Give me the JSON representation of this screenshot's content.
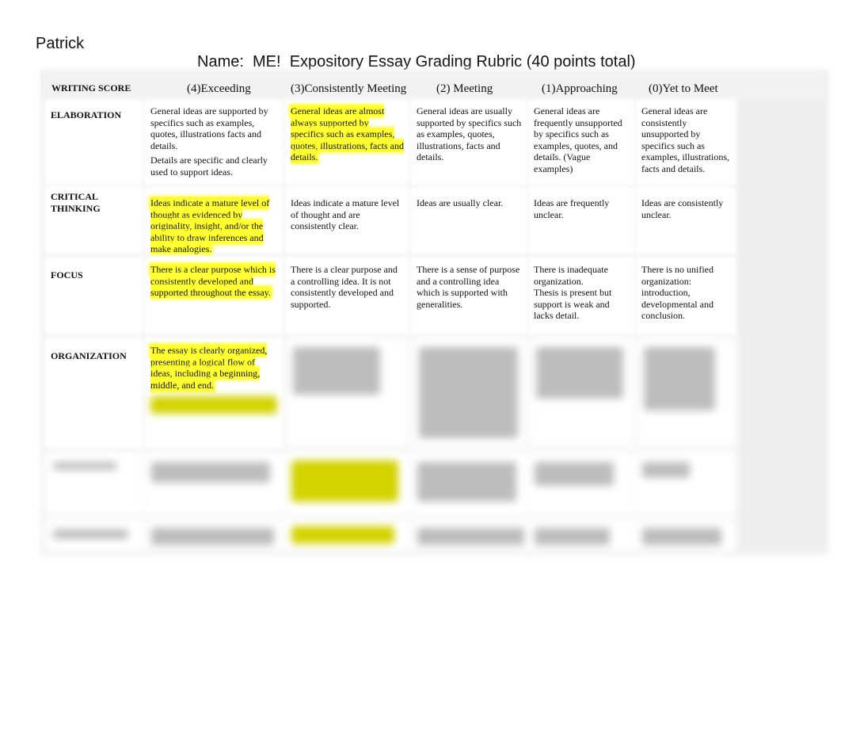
{
  "header": {
    "student_name": "Patrick",
    "title": "Name:  ME!  Expository Essay Grading Rubric (40 points total)"
  },
  "rubric": {
    "corner_label": "WRITING SCORE",
    "columns": [
      "(4)Exceeding",
      "(3)Consistently Meeting",
      "(2) Meeting",
      "(1)Approaching",
      "(0)Yet to Meet"
    ],
    "rows": [
      {
        "label": "ELABORATION",
        "cells": [
          {
            "text": "General ideas are supported by specifics such as examples, quotes, illustrations facts and details.",
            "text2": "Details are specific and clearly used to support ideas.",
            "highlighted": false
          },
          {
            "text": "General ideas are almost always supported by specifics such as examples, quotes, illustrations, facts and details.",
            "highlighted": true
          },
          {
            "text": "General ideas are usually supported by specifics such as examples, quotes, illustrations, facts and details.",
            "highlighted": false
          },
          {
            "text": "General ideas are frequently unsupported by specifics such as examples, quotes, and details. (Vague examples)",
            "highlighted": false
          },
          {
            "text": "General ideas are consistently unsupported by specifics such as examples, illustrations, facts and details.",
            "highlighted": false
          }
        ]
      },
      {
        "label": "CRITICAL THINKING",
        "cells": [
          {
            "text": "Ideas indicate a mature level of thought as evidenced by originality, insight, and/or the ability to draw inferences and make analogies.",
            "highlighted": true
          },
          {
            "text": "Ideas indicate a mature level of thought and are consistently clear.",
            "highlighted": false
          },
          {
            "text": "Ideas are usually clear.",
            "highlighted": false
          },
          {
            "text": "Ideas are frequently unclear.",
            "highlighted": false
          },
          {
            "text": "Ideas are consistently unclear.",
            "highlighted": false
          }
        ]
      },
      {
        "label": "FOCUS",
        "cells": [
          {
            "text": "There is a clear purpose which is consistently developed and supported throughout the essay.",
            "highlighted": true
          },
          {
            "text": "There is a clear purpose and a controlling idea. It is not consistently developed and supported.",
            "highlighted": false
          },
          {
            "text": "There is a sense of purpose and a controlling idea which is supported with generalities.",
            "highlighted": false
          },
          {
            "text": "There is inadequate organization.",
            "text2": "Thesis is present but support is weak and lacks detail.",
            "highlighted": false
          },
          {
            "text": "There is no unified organization: introduction, developmental and conclusion.",
            "highlighted": false
          }
        ]
      },
      {
        "label": "ORGANIZATION",
        "cells": [
          {
            "text": "The essay is clearly organized, presenting a logical flow of ideas, including a beginning, middle, and end.",
            "highlighted": true
          }
        ]
      }
    ]
  }
}
